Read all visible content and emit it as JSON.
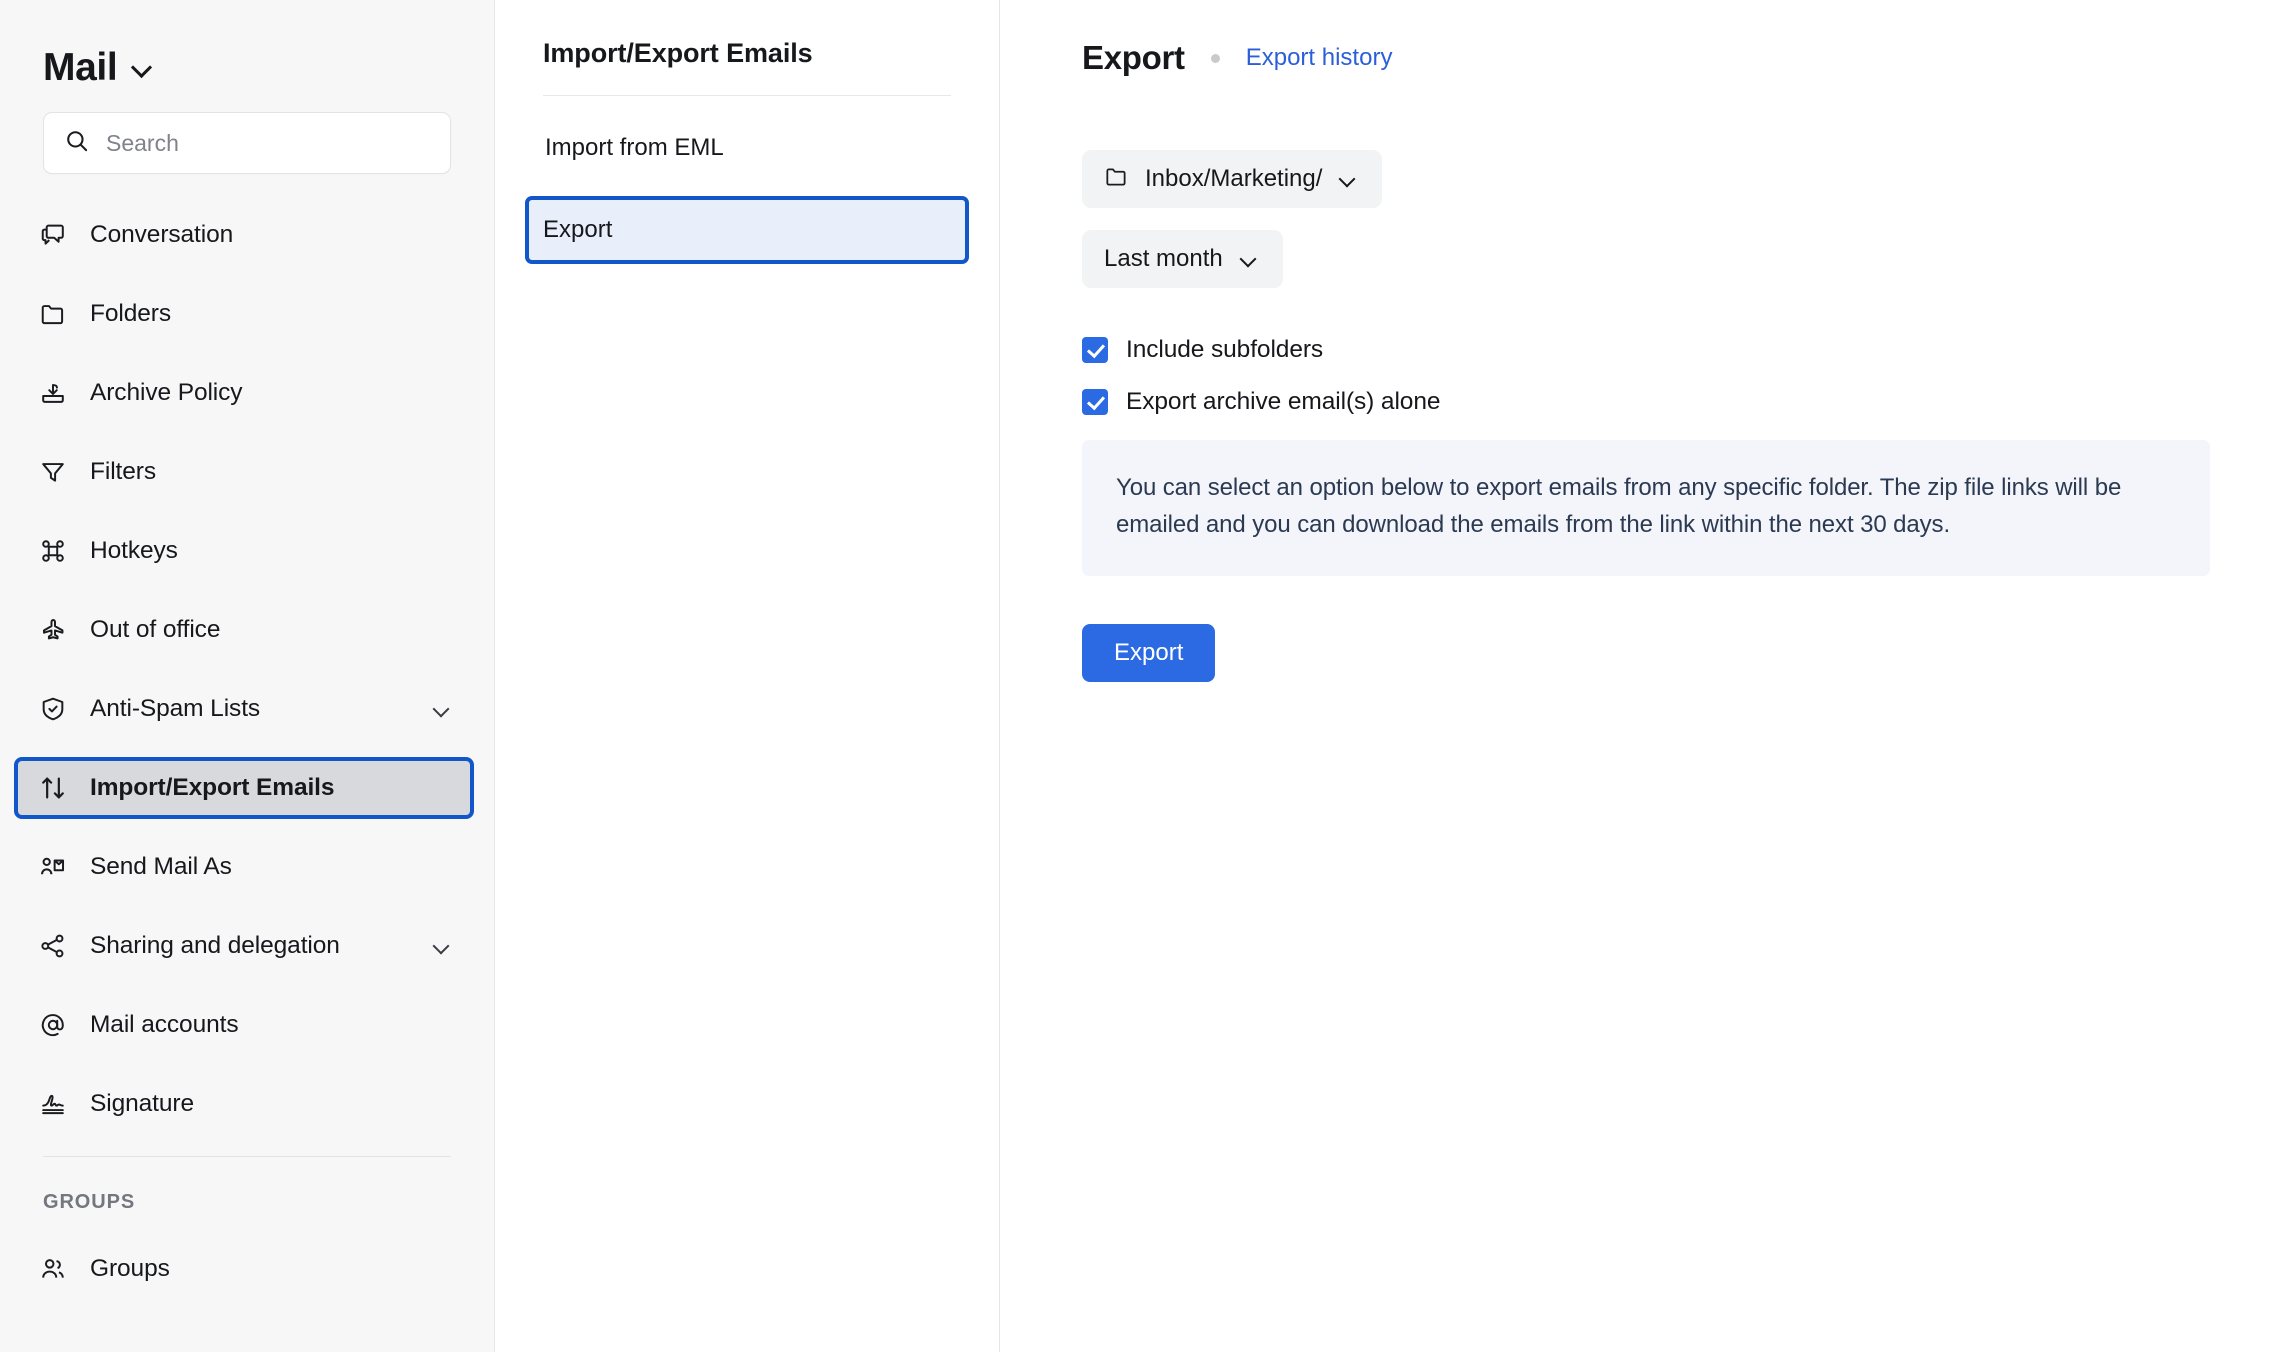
{
  "sidebar": {
    "brand": {
      "title": "Mail",
      "chevron_icon": "chevron-down-icon"
    },
    "search": {
      "placeholder": "Search",
      "value": "",
      "icon": "search-icon"
    },
    "items": [
      {
        "label": "Conversation",
        "icon": "conversation-icon",
        "selected": false,
        "chevron": false
      },
      {
        "label": "Folders",
        "icon": "folder-icon",
        "selected": false,
        "chevron": false
      },
      {
        "label": "Archive Policy",
        "icon": "archive-icon",
        "selected": false,
        "chevron": false
      },
      {
        "label": "Filters",
        "icon": "filter-icon",
        "selected": false,
        "chevron": false
      },
      {
        "label": "Hotkeys",
        "icon": "command-icon",
        "selected": false,
        "chevron": false
      },
      {
        "label": "Out of office",
        "icon": "airplane-icon",
        "selected": false,
        "chevron": false
      },
      {
        "label": "Anti-Spam Lists",
        "icon": "shield-check-icon",
        "selected": false,
        "chevron": true
      },
      {
        "label": "Import/Export Emails",
        "icon": "arrows-updown-icon",
        "selected": true,
        "chevron": false
      },
      {
        "label": "Send Mail As",
        "icon": "user-send-icon",
        "selected": false,
        "chevron": false
      },
      {
        "label": "Sharing and delegation",
        "icon": "share-nodes-icon",
        "selected": false,
        "chevron": true
      },
      {
        "label": "Mail accounts",
        "icon": "at-sign-icon",
        "selected": false,
        "chevron": false
      },
      {
        "label": "Signature",
        "icon": "signature-icon",
        "selected": false,
        "chevron": false
      }
    ],
    "groups_section": {
      "header": "GROUPS",
      "items": [
        {
          "label": "Groups",
          "icon": "users-icon"
        }
      ]
    }
  },
  "midpanel": {
    "title": "Import/Export Emails",
    "items": [
      {
        "label": "Import from EML",
        "selected": false
      },
      {
        "label": "Export",
        "selected": true
      }
    ]
  },
  "main": {
    "title": "Export",
    "history_link": "Export history",
    "folder_select": {
      "value": "Inbox/Marketing/",
      "icon": "folder-icon",
      "chevron_icon": "chevron-down-icon"
    },
    "date_select": {
      "value": "Last month",
      "chevron_icon": "chevron-down-icon"
    },
    "checkboxes": [
      {
        "label": "Include subfolders",
        "checked": true
      },
      {
        "label": "Export archive email(s) alone",
        "checked": true
      }
    ],
    "info_text": "You can select an option below to export emails from any specific folder. The zip file links will be emailed and you can download the emails from the link within the next 30 days.",
    "submit_label": "Export"
  },
  "colors": {
    "accent_blue": "#2b6ae3",
    "link_blue": "#2b5fd9",
    "highlight_border": "#1257c9",
    "sidebar_bg": "#f7f7f8",
    "selected_nav_bg": "#d8d9dc",
    "selected_mid_bg": "#e8effb",
    "info_bg": "#f3f5fa",
    "info_text": "#2b3a52"
  }
}
